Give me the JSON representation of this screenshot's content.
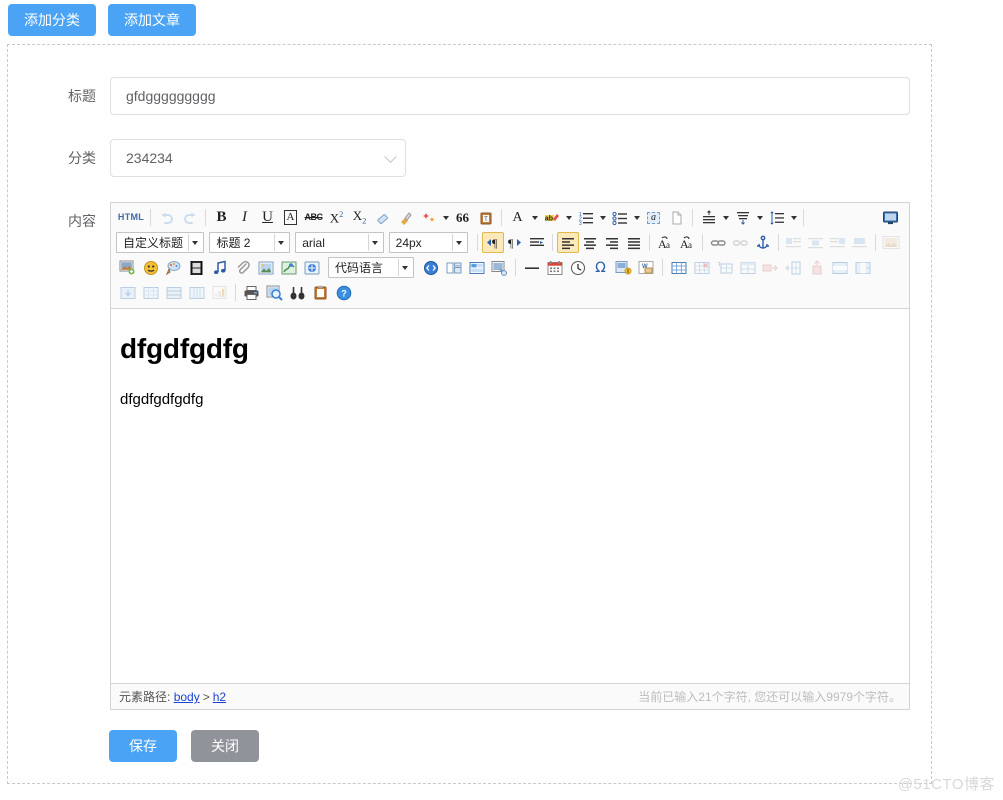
{
  "topbar": {
    "add_category_label": "添加分类",
    "add_article_label": "添加文章"
  },
  "form": {
    "title_label": "标题",
    "title_value": "gfdggggggggg",
    "title_placeholder": "",
    "category_label": "分类",
    "category_value": "234234",
    "content_label": "内容"
  },
  "editor": {
    "toolbar": {
      "row1": [
        {
          "name": "source-html",
          "label": "HTML",
          "title": "源代码"
        },
        {
          "name": "undo-icon",
          "title": "撤销"
        },
        {
          "name": "redo-icon",
          "title": "重做"
        },
        {
          "name": "bold-icon",
          "label": "B",
          "title": "加粗"
        },
        {
          "name": "italic-icon",
          "label": "I",
          "title": "斜体"
        },
        {
          "name": "underline-icon",
          "label": "U",
          "title": "下划线"
        },
        {
          "name": "border-text-icon",
          "label": "A",
          "title": "边框"
        },
        {
          "name": "strikethrough-icon",
          "label": "ABC",
          "title": "删除线"
        },
        {
          "name": "superscript-icon",
          "title": "上标"
        },
        {
          "name": "subscript-icon",
          "title": "下标"
        },
        {
          "name": "eraser-icon",
          "title": "清除格式"
        },
        {
          "name": "brush-icon",
          "title": "格式刷"
        },
        {
          "name": "autotypeset-icon",
          "title": "自动排版"
        },
        {
          "name": "blockquote-icon",
          "label": "66",
          "title": "引用"
        },
        {
          "name": "pastetext-icon",
          "title": "纯文本粘贴"
        },
        {
          "name": "forecolor-icon",
          "label": "A",
          "title": "字体颜色"
        },
        {
          "name": "backcolor-icon",
          "label": "ab",
          "title": "背景色"
        },
        {
          "name": "ordered-list-icon",
          "title": "有序列表"
        },
        {
          "name": "unordered-list-icon",
          "title": "无序列表"
        },
        {
          "name": "anchor-icon",
          "label": "a",
          "title": "锚点"
        },
        {
          "name": "pagebreak-icon",
          "title": "分页"
        },
        {
          "name": "line-height-icon",
          "title": "行间距"
        },
        {
          "name": "paragraph-spacing-icon",
          "title": "段间距"
        },
        {
          "name": "spacing-icon",
          "title": "间距"
        },
        {
          "name": "fullscreen-icon",
          "title": "全屏"
        }
      ],
      "row2_selects": [
        {
          "name": "custom-style-select",
          "value": "自定义标题"
        },
        {
          "name": "paragraph-format-select",
          "value": "标题 2"
        },
        {
          "name": "font-family-select",
          "value": "arial"
        },
        {
          "name": "font-size-select",
          "value": "24px"
        }
      ],
      "row2": [
        {
          "name": "direction-ltr-icon",
          "title": "从左向右",
          "active": true
        },
        {
          "name": "direction-rtl-icon",
          "title": "从右向左"
        },
        {
          "name": "indent-icon",
          "title": "首行缩进"
        },
        {
          "name": "align-left-icon",
          "title": "居左对齐",
          "active": true
        },
        {
          "name": "align-center-icon",
          "title": "居中对齐"
        },
        {
          "name": "align-right-icon",
          "title": "居右对齐"
        },
        {
          "name": "align-justify-icon",
          "title": "两端对齐"
        },
        {
          "name": "uppercase-icon",
          "title": "字母大写"
        },
        {
          "name": "lowercase-icon",
          "title": "字母小写"
        },
        {
          "name": "link-icon",
          "title": "超链接"
        },
        {
          "name": "unlink-icon",
          "title": "取消链接",
          "disabled": true
        },
        {
          "name": "anchor-marker-icon",
          "title": "锚点"
        },
        {
          "name": "img-float-left-icon",
          "title": "左浮动",
          "disabled": true
        },
        {
          "name": "img-float-none-icon",
          "title": "默认",
          "disabled": true
        },
        {
          "name": "img-float-right-icon",
          "title": "右浮动",
          "disabled": true
        },
        {
          "name": "img-center-icon",
          "title": "居中",
          "disabled": true
        },
        {
          "name": "background-image-icon",
          "title": "背景",
          "disabled": true
        }
      ],
      "row3": [
        {
          "name": "insert-image-icon",
          "title": "多图上传"
        },
        {
          "name": "emoticon-icon",
          "title": "表情"
        },
        {
          "name": "scrawl-icon",
          "title": "涂鸦"
        },
        {
          "name": "insert-video-icon",
          "title": "视频"
        },
        {
          "name": "music-icon",
          "title": "音乐"
        },
        {
          "name": "attachment-icon",
          "title": "附件"
        },
        {
          "name": "image-gallery-icon",
          "title": "图片库"
        },
        {
          "name": "map-icon",
          "title": "地图"
        },
        {
          "name": "webapp-icon",
          "title": "百度应用"
        }
      ],
      "code_select": {
        "name": "code-language-select",
        "value": "代码语言"
      },
      "row3b": [
        {
          "name": "insert-code-icon",
          "title": "插入代码"
        },
        {
          "name": "template-layout-icon",
          "title": "排版"
        },
        {
          "name": "table-layout-icon",
          "title": "表格布局"
        },
        {
          "name": "wordimage-icon",
          "title": "图片转存"
        },
        {
          "name": "horizontal-rule-icon",
          "title": "分隔线"
        },
        {
          "name": "insert-date-icon",
          "title": "日期"
        },
        {
          "name": "insert-time-icon",
          "title": "时间"
        },
        {
          "name": "special-character-icon",
          "label": "Ω",
          "title": "特殊字符"
        },
        {
          "name": "template-icon",
          "title": "模板"
        },
        {
          "name": "word-paste-icon",
          "title": "word图片转存"
        },
        {
          "name": "insert-table-icon",
          "title": "插入表格"
        },
        {
          "name": "delete-table-icon",
          "title": "删除表格",
          "disabled": true
        },
        {
          "name": "table-title-icon",
          "title": "表格标题",
          "disabled": true
        },
        {
          "name": "merge-cells-icon",
          "title": "合并单元格",
          "disabled": true
        },
        {
          "name": "split-cell-right-icon",
          "title": "拆分单元格",
          "disabled": true
        },
        {
          "name": "split-cell-down-icon",
          "title": "拆分行",
          "disabled": true
        },
        {
          "name": "split-cell-col-icon",
          "title": "拆分列",
          "disabled": true
        },
        {
          "name": "insert-row-icon",
          "title": "插入行",
          "disabled": true
        },
        {
          "name": "insert-col-icon",
          "title": "插入列",
          "disabled": true
        }
      ],
      "row4": [
        {
          "name": "delete-row-icon",
          "title": "删除行",
          "disabled": true
        },
        {
          "name": "delete-col-icon",
          "title": "删除列",
          "disabled": true
        },
        {
          "name": "table-sort-icon",
          "title": "表格排序",
          "disabled": true
        },
        {
          "name": "table-border-icon",
          "title": "边框",
          "disabled": true
        },
        {
          "name": "chart-icon",
          "title": "图表",
          "disabled": true
        },
        {
          "name": "print-icon",
          "title": "打印"
        },
        {
          "name": "preview-icon",
          "title": "预览"
        },
        {
          "name": "search-replace-icon",
          "title": "查询替换"
        },
        {
          "name": "clipboard-icon",
          "title": "粘贴板"
        },
        {
          "name": "help-icon",
          "title": "帮助"
        }
      ]
    },
    "content": {
      "heading": "dfgdfgdfg",
      "paragraph": "dfgdfgdfgdfg"
    },
    "statusbar": {
      "path_label": "元素路径:",
      "path_items": [
        "body",
        "h2"
      ],
      "path_separator": ">",
      "char_count": "当前已输入21个字符, 您还可以输入9979个字符。"
    }
  },
  "footer": {
    "save_label": "保存",
    "close_label": "关闭"
  },
  "watermark": "@51CTO博客",
  "colors": {
    "primary": "#4aa3f5",
    "gray": "#909399",
    "link": "#1a44d6",
    "border": "#dcdfe6"
  }
}
